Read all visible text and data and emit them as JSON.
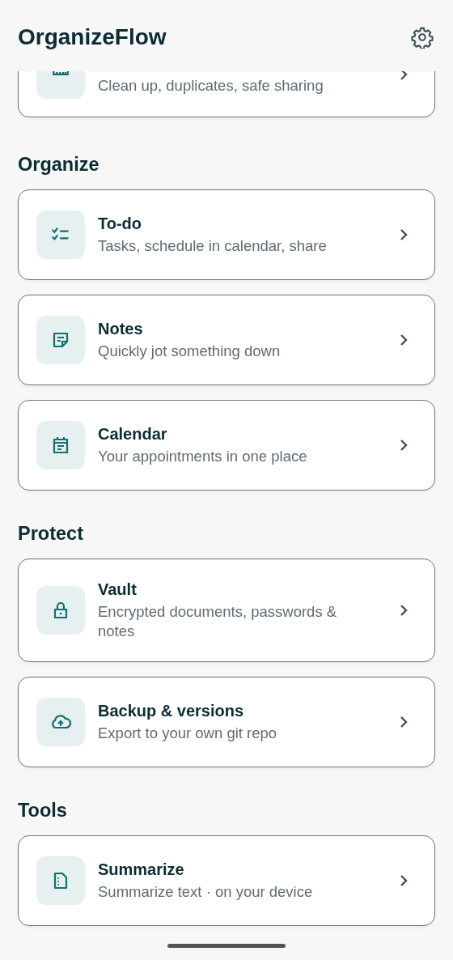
{
  "app_bar": {
    "title": "OrganizeFlow"
  },
  "partial_card": {
    "subtitle": "Clean up, duplicates, safe sharing",
    "kind": "ruler"
  },
  "sections": [
    {
      "heading": "Organize",
      "items": [
        {
          "title": "To-do",
          "subtitle": "Tasks, schedule in calendar, share",
          "kind": "checklist"
        },
        {
          "title": "Notes",
          "subtitle": "Quickly jot something down",
          "kind": "note"
        },
        {
          "title": "Calendar",
          "subtitle": "Your appointments in one place",
          "kind": "calendar"
        }
      ]
    },
    {
      "heading": "Protect",
      "items": [
        {
          "title": "Vault",
          "subtitle": "Encrypted documents, passwords & notes",
          "kind": "lock"
        },
        {
          "title": "Backup & versions",
          "subtitle": "Export to your own git repo",
          "kind": "cloud"
        }
      ]
    },
    {
      "heading": "Tools",
      "items": [
        {
          "title": "Summarize",
          "subtitle": "Summarize text · on your device",
          "kind": "document"
        }
      ]
    }
  ]
}
